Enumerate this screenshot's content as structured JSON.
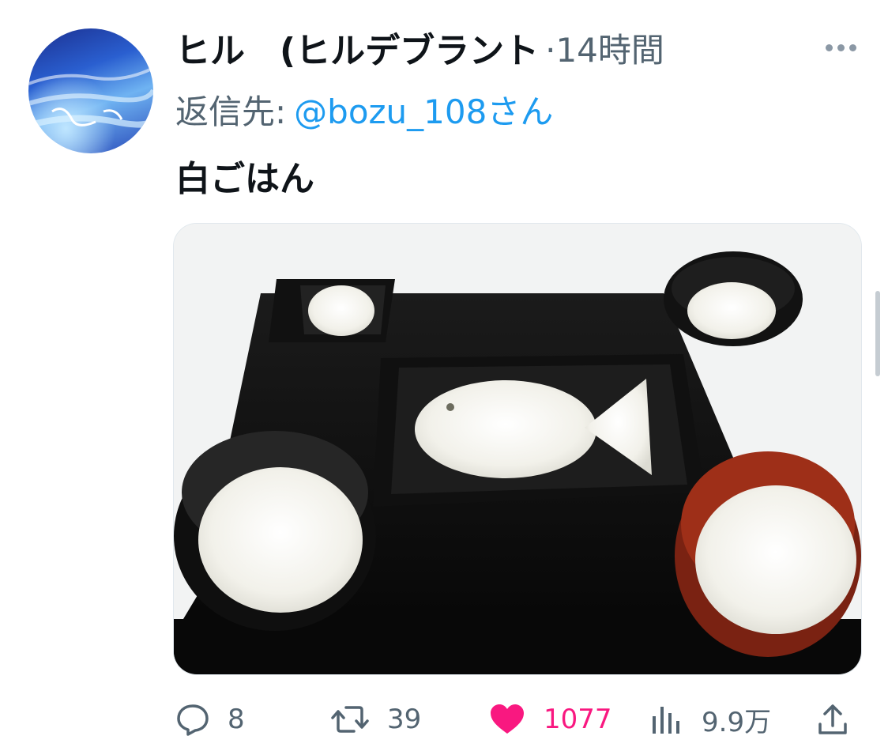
{
  "post": {
    "author_name": "ヒル　(ヒルデブラント",
    "time_label": "·14時間",
    "reply_prefix": "返信先:",
    "reply_target": "@bozu_108さん",
    "text": "白ごはん",
    "media_alt": "黒いお盆に盛られた白ごはんの定食（魚の形のごはん、茶碗、汁椀、小鉢）"
  },
  "actions": {
    "reply_count": "8",
    "retweet_count": "39",
    "like_count": "1077",
    "views_count": "9.9万"
  },
  "icons": {
    "more": "more-horizontal-icon",
    "reply": "speech-bubble-icon",
    "retweet": "retweet-arrows-icon",
    "like": "heart-icon",
    "views": "bar-chart-icon",
    "share": "share-upload-icon"
  },
  "colors": {
    "text_primary": "#0f1419",
    "text_secondary": "#536471",
    "link": "#1d9bf0",
    "like": "#f91880"
  }
}
